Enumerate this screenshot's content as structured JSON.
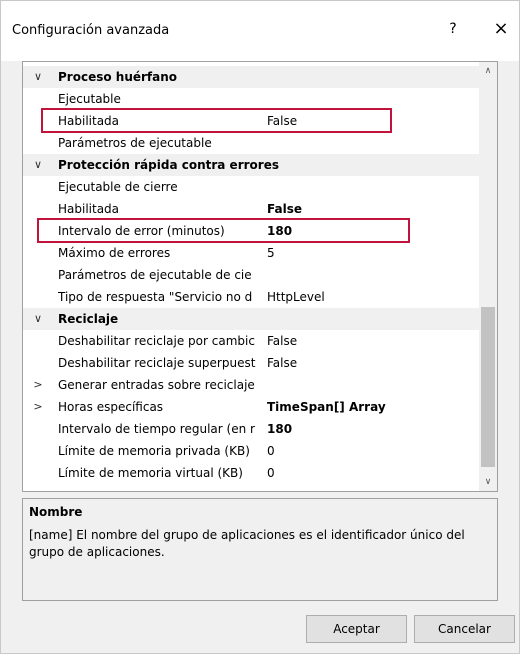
{
  "window": {
    "title": "Configuración avanzada",
    "help_label": "?",
    "close_label": "×"
  },
  "grid": {
    "rows": [
      {
        "type": "category",
        "expander": "∨",
        "name": "Proceso huérfano"
      },
      {
        "type": "prop",
        "expander": "",
        "name": "Ejecutable",
        "value": ""
      },
      {
        "type": "prop",
        "expander": "",
        "name": "Habilitada",
        "value": "False",
        "bold": false,
        "highlight": true
      },
      {
        "type": "prop",
        "expander": "",
        "name": "Parámetros de ejecutable",
        "value": ""
      },
      {
        "type": "category",
        "expander": "∨",
        "name": "Protección rápida contra errores"
      },
      {
        "type": "prop",
        "expander": "",
        "name": "Ejecutable de cierre",
        "value": ""
      },
      {
        "type": "prop",
        "expander": "",
        "name": "Habilitada",
        "value": "False",
        "bold": true
      },
      {
        "type": "prop",
        "expander": "",
        "name": "Intervalo de error (minutos)",
        "value": "180",
        "bold": true,
        "highlight": true
      },
      {
        "type": "prop",
        "expander": "",
        "name": "Máximo de errores",
        "value": "5"
      },
      {
        "type": "prop",
        "expander": "",
        "name": "Parámetros de ejecutable de cie",
        "value": ""
      },
      {
        "type": "prop",
        "expander": "",
        "name": "Tipo de respuesta \"Servicio no d",
        "value": "HttpLevel"
      },
      {
        "type": "category",
        "expander": "∨",
        "name": "Reciclaje"
      },
      {
        "type": "prop",
        "expander": "",
        "name": "Deshabilitar reciclaje por cambic",
        "value": "False"
      },
      {
        "type": "prop",
        "expander": "",
        "name": "Deshabilitar reciclaje superpuest",
        "value": "False"
      },
      {
        "type": "prop",
        "expander": ">",
        "name": "Generar entradas sobre reciclaje",
        "value": ""
      },
      {
        "type": "prop",
        "expander": ">",
        "name": "Horas específicas",
        "value": "TimeSpan[] Array",
        "bold": true
      },
      {
        "type": "prop",
        "expander": "",
        "name": "Intervalo de tiempo regular (en r",
        "value": "180",
        "bold": true
      },
      {
        "type": "prop",
        "expander": "",
        "name": "Límite de memoria privada (KB)",
        "value": "0"
      },
      {
        "type": "prop",
        "expander": "",
        "name": "Límite de memoria virtual (KB)",
        "value": "0"
      }
    ]
  },
  "scroll": {
    "up": "∧",
    "down": "∨"
  },
  "description": {
    "title": "Nombre",
    "text": "[name] El nombre del grupo de aplicaciones es el identificador único del grupo de aplicaciones."
  },
  "buttons": {
    "ok": "Aceptar",
    "cancel": "Cancelar"
  },
  "colors": {
    "highlight": "#c0143c"
  }
}
